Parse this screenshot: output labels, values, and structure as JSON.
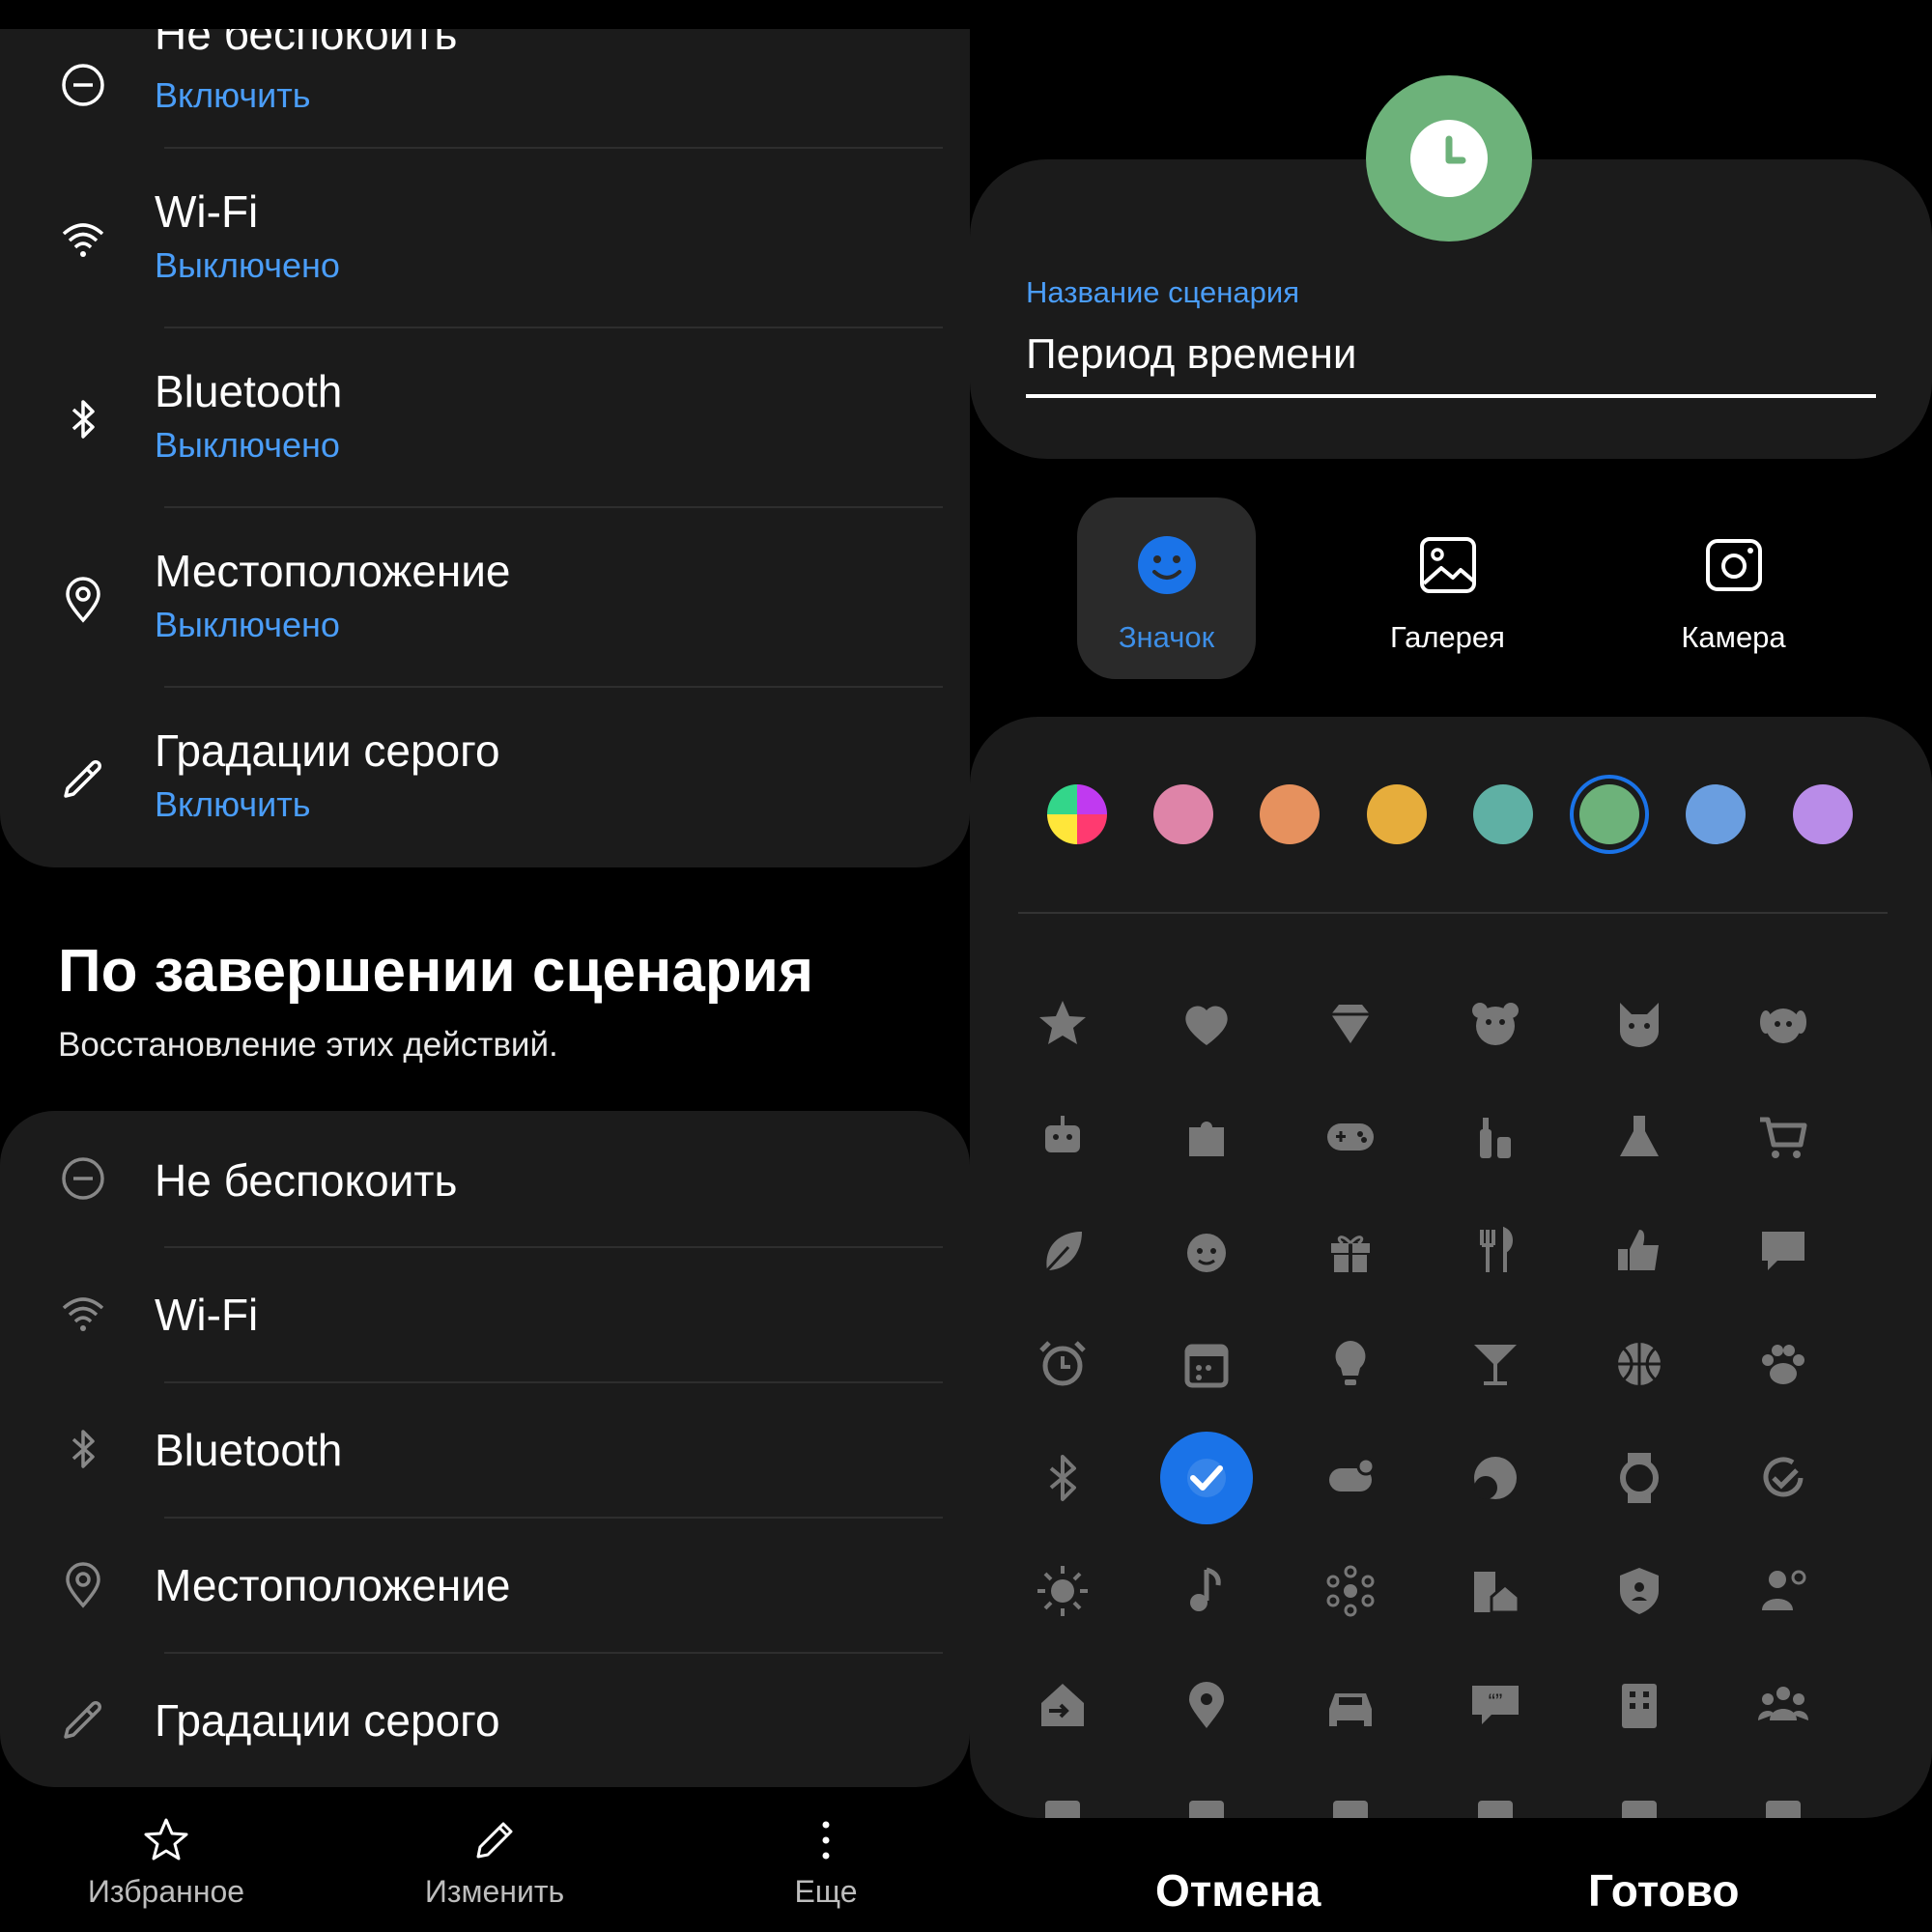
{
  "left": {
    "start_actions": [
      {
        "title": "Не беспокоить",
        "status": "Включить",
        "icon": "minus-circle-icon"
      },
      {
        "title": "Wi-Fi",
        "status": "Выключено",
        "icon": "wifi-icon"
      },
      {
        "title": "Bluetooth",
        "status": "Выключено",
        "icon": "bluetooth-icon"
      },
      {
        "title": "Местоположение",
        "status": "Выключено",
        "icon": "location-icon"
      },
      {
        "title": "Градации серого",
        "status": "Включить",
        "icon": "eyedropper-icon"
      }
    ],
    "end_section": {
      "title": "По завершении сценария",
      "subtitle": "Восстановление этих действий."
    },
    "end_actions": [
      {
        "title": "Не беспокоить",
        "icon": "minus-circle-icon"
      },
      {
        "title": "Wi-Fi",
        "icon": "wifi-icon"
      },
      {
        "title": "Bluetooth",
        "icon": "bluetooth-icon"
      },
      {
        "title": "Местоположение",
        "icon": "location-icon"
      },
      {
        "title": "Градации серого",
        "icon": "eyedropper-icon"
      }
    ],
    "bottom_nav": {
      "favorite": "Избранное",
      "edit": "Изменить",
      "more": "Еще"
    }
  },
  "right": {
    "avatar_icon": "clock-icon",
    "avatar_color": "#6db27a",
    "name_label": "Название сценария",
    "name_value": "Период времени",
    "tabs": {
      "icon": "Значок",
      "gallery": "Галерея",
      "camera": "Камера"
    },
    "colors": [
      "multicolor",
      "#de84a8",
      "#e6915e",
      "#e6ad3c",
      "#5fb0a4",
      "#6db27a",
      "#6a9ee0",
      "#b98ce8"
    ],
    "selected_color_index": 5,
    "icons": [
      "star-icon",
      "heart-icon",
      "diamond-icon",
      "bear-icon",
      "cat-icon",
      "dog-icon",
      "robot-icon",
      "puzzle-icon",
      "gamepad-icon",
      "bottles-icon",
      "flask-icon",
      "cart-icon",
      "leaf-icon",
      "baby-icon",
      "gift-icon",
      "cutlery-icon",
      "thumbs-up-icon",
      "chat-icon",
      "alarm-icon",
      "calendar-icon",
      "bulb-icon",
      "cocktail-icon",
      "basketball-icon",
      "paw-icon",
      "bluetooth-icon",
      "check-selected-icon",
      "toggle-icon",
      "moon-icon",
      "watch-icon",
      "refresh-check-icon",
      "sun-icon",
      "music-icon",
      "molecule-icon",
      "house-icon",
      "shield-icon",
      "person-icon",
      "enter-home-icon",
      "pin-icon",
      "car-icon",
      "quote-icon",
      "building-icon",
      "group-icon"
    ],
    "selected_icon_index": 25,
    "footer": {
      "cancel": "Отмена",
      "done": "Готово"
    },
    "accent": "#1a73e8"
  }
}
